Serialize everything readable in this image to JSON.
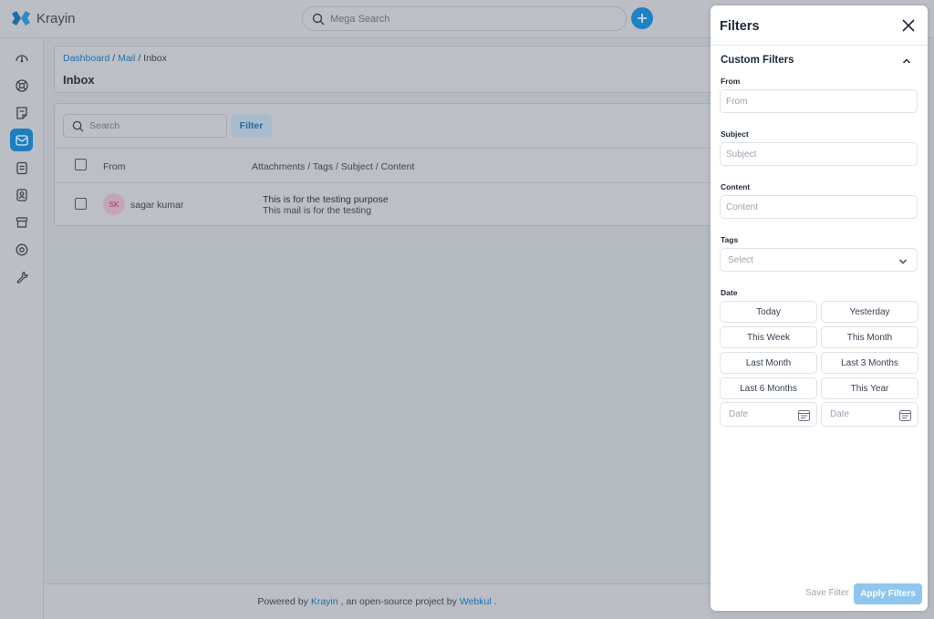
{
  "app": {
    "name": "Krayin",
    "brand_color": "#0E90D9"
  },
  "header": {
    "search_placeholder": "Mega Search"
  },
  "sidebar": {
    "items": [
      {
        "icon": "dashboard-icon",
        "active": false
      },
      {
        "icon": "leads-icon",
        "active": false
      },
      {
        "icon": "quotes-icon",
        "active": false
      },
      {
        "icon": "mail-icon",
        "active": true
      },
      {
        "icon": "activities-icon",
        "active": false
      },
      {
        "icon": "contacts-icon",
        "active": false
      },
      {
        "icon": "products-icon",
        "active": false
      },
      {
        "icon": "settings-icon",
        "active": false
      },
      {
        "icon": "configuration-icon",
        "active": false
      }
    ]
  },
  "breadcrumb": {
    "dashboard": "Dashboard",
    "mail": "Mail",
    "current": "Inbox",
    "sep": "/"
  },
  "page": {
    "title": "Inbox"
  },
  "toolbar": {
    "search_placeholder": "Search",
    "filter_label": "Filter"
  },
  "table": {
    "columns": [
      "From",
      "Attachments / Tags / Subject / Content"
    ],
    "rows": [
      {
        "initials": "SK",
        "from": "sagar kumar",
        "subject": "This is for the testing purpose",
        "content": "This mail is for the testing"
      }
    ]
  },
  "footer": {
    "prefix": "Powered by",
    "krayin": "Krayin",
    "middle": ", an open-source project by",
    "webkul": "Webkul",
    "suffix": "."
  },
  "filters": {
    "title": "Filters",
    "section": "Custom Filters",
    "from": {
      "label": "From",
      "placeholder": "From"
    },
    "subject": {
      "label": "Subject",
      "placeholder": "Subject"
    },
    "content": {
      "label": "Content",
      "placeholder": "Content"
    },
    "tags": {
      "label": "Tags",
      "placeholder": "Select"
    },
    "date": {
      "label": "Date",
      "presets": [
        "Today",
        "Yesterday",
        "This Week",
        "This Month",
        "Last Month",
        "Last 3 Months",
        "Last 6 Months",
        "This Year"
      ],
      "start_placeholder": "Date",
      "end_placeholder": "Date"
    },
    "save_label": "Save Filter",
    "apply_label": "Apply Filters"
  }
}
